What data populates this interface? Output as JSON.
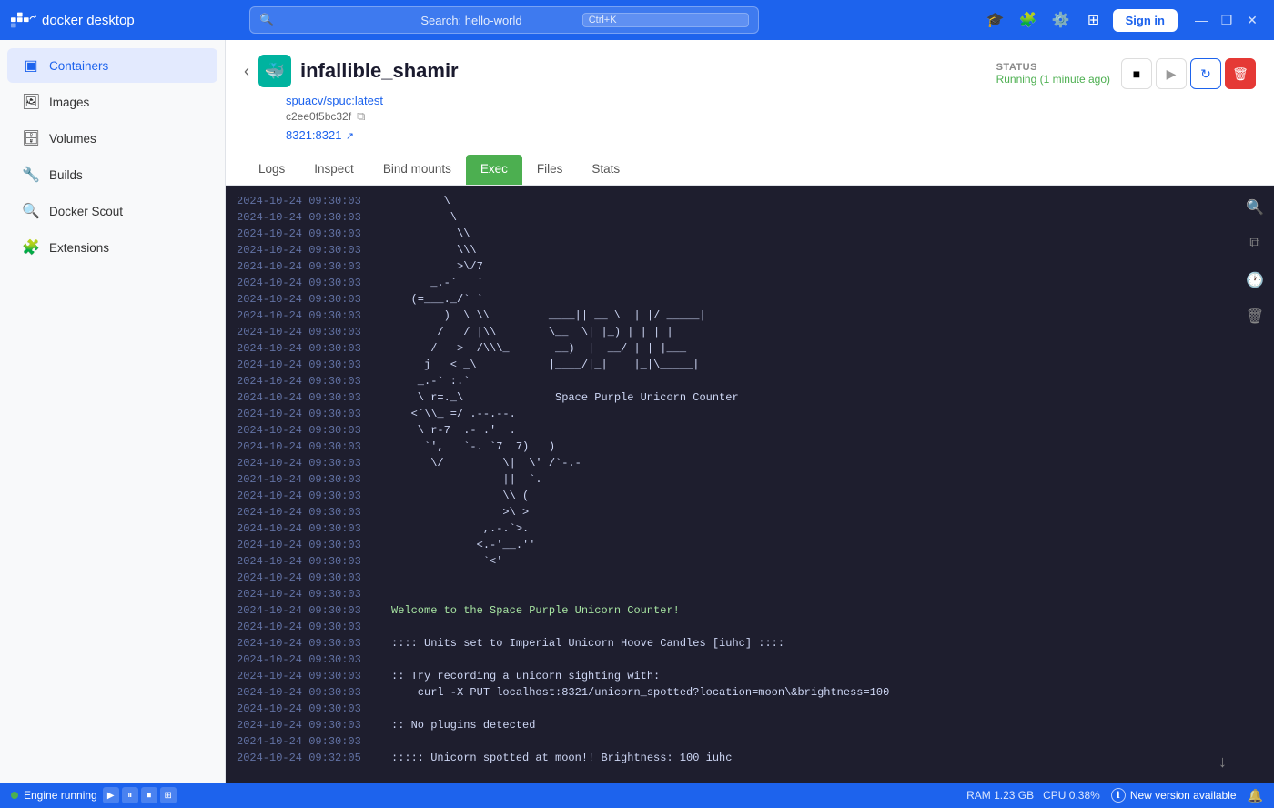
{
  "app": {
    "title": "Docker Desktop",
    "logo_text": "docker desktop"
  },
  "topbar": {
    "search_placeholder": "Search: hello-world",
    "shortcut": "Ctrl+K",
    "sign_in_label": "Sign in",
    "win_minimize": "—",
    "win_maximize": "❐",
    "win_close": "✕"
  },
  "sidebar": {
    "items": [
      {
        "id": "containers",
        "label": "Containers",
        "icon": "▣",
        "active": true
      },
      {
        "id": "images",
        "label": "Images",
        "icon": "🖼"
      },
      {
        "id": "volumes",
        "label": "Volumes",
        "icon": "🗄"
      },
      {
        "id": "builds",
        "label": "Builds",
        "icon": "🔧"
      },
      {
        "id": "docker-scout",
        "label": "Docker Scout",
        "icon": "🔍"
      },
      {
        "id": "extensions",
        "label": "Extensions",
        "icon": "🧩"
      }
    ]
  },
  "container": {
    "name": "infallible_shamir",
    "image_link": "spuacv/spuc:latest",
    "id": "c2ee0f5bc32f",
    "port": "8321:8321",
    "status_label": "STATUS",
    "status_text": "Running (1 minute ago)"
  },
  "tabs": [
    {
      "id": "logs",
      "label": "Logs",
      "active": false
    },
    {
      "id": "inspect",
      "label": "Inspect",
      "active": false
    },
    {
      "id": "bind-mounts",
      "label": "Bind mounts",
      "active": false
    },
    {
      "id": "exec",
      "label": "Exec",
      "active": true
    },
    {
      "id": "files",
      "label": "Files",
      "active": false
    },
    {
      "id": "stats",
      "label": "Stats",
      "active": false
    }
  ],
  "logs": [
    {
      "ts": "2024-10-24 09:30:03",
      "content": "        \\"
    },
    {
      "ts": "2024-10-24 09:30:03",
      "content": "         \\"
    },
    {
      "ts": "2024-10-24 09:30:03",
      "content": "          \\\\"
    },
    {
      "ts": "2024-10-24 09:30:03",
      "content": "          \\\\\\"
    },
    {
      "ts": "2024-10-24 09:30:03",
      "content": "          >\\/7"
    },
    {
      "ts": "2024-10-24 09:30:03",
      "content": "      _.-`   `"
    },
    {
      "ts": "2024-10-24 09:30:03",
      "content": "   (=___._/` `"
    },
    {
      "ts": "2024-10-24 09:30:03",
      "content": "        )  \\ \\\\         ____|| __ \\  | |/ _____|"
    },
    {
      "ts": "2024-10-24 09:30:03",
      "content": "       /   / |\\\\        \\__  \\| |_) | | | |"
    },
    {
      "ts": "2024-10-24 09:30:03",
      "content": "      /   >  /\\\\\\_       __)  |  __/ | | |___"
    },
    {
      "ts": "2024-10-24 09:30:03",
      "content": "     j   < _\\           |____/|_|    |_|\\_____|"
    },
    {
      "ts": "2024-10-24 09:30:03",
      "content": "    _.-` :.`"
    },
    {
      "ts": "2024-10-24 09:30:03",
      "content": "    \\ r=._\\              Space Purple Unicorn Counter"
    },
    {
      "ts": "2024-10-24 09:30:03",
      "content": "   <`\\\\_ =/ .--.--."
    },
    {
      "ts": "2024-10-24 09:30:03",
      "content": "    \\ r-7  .- .'  ."
    },
    {
      "ts": "2024-10-24 09:30:03",
      "content": "     `',   `-. `7  7)   )"
    },
    {
      "ts": "2024-10-24 09:30:03",
      "content": "      \\/         \\|  \\' /`-.-"
    },
    {
      "ts": "2024-10-24 09:30:03",
      "content": "                 ||  `."
    },
    {
      "ts": "2024-10-24 09:30:03",
      "content": "                 \\\\ ("
    },
    {
      "ts": "2024-10-24 09:30:03",
      "content": "                 >\\ >"
    },
    {
      "ts": "2024-10-24 09:30:03",
      "content": "              ,.-.`>."
    },
    {
      "ts": "2024-10-24 09:30:03",
      "content": "             <.-'__.''"
    },
    {
      "ts": "2024-10-24 09:30:03",
      "content": "              `<'"
    },
    {
      "ts": "2024-10-24 09:30:03",
      "content": ""
    },
    {
      "ts": "2024-10-24 09:30:03",
      "content": ""
    },
    {
      "ts": "2024-10-24 09:30:03",
      "content": "Welcome to the Space Purple Unicorn Counter!",
      "highlight": true
    },
    {
      "ts": "2024-10-24 09:30:03",
      "content": ""
    },
    {
      "ts": "2024-10-24 09:30:03",
      "content": ":::: Units set to Imperial Unicorn Hoove Candles [iuhc] ::::"
    },
    {
      "ts": "2024-10-24 09:30:03",
      "content": ""
    },
    {
      "ts": "2024-10-24 09:30:03",
      "content": ":: Try recording a unicorn sighting with:"
    },
    {
      "ts": "2024-10-24 09:30:03",
      "content": "    curl -X PUT localhost:8321/unicorn_spotted?location=moon\\&brightness=100"
    },
    {
      "ts": "2024-10-24 09:30:03",
      "content": ""
    },
    {
      "ts": "2024-10-24 09:30:03",
      "content": ":: No plugins detected"
    },
    {
      "ts": "2024-10-24 09:30:03",
      "content": ""
    },
    {
      "ts": "2024-10-24 09:32:05",
      "content": "::::: Unicorn spotted at moon!! Brightness: 100 iuhc"
    }
  ],
  "bottom_bar": {
    "engine_label": "Engine running",
    "ram_label": "RAM 1.23 GB",
    "cpu_label": "CPU 0.38%",
    "new_version_label": "New version available"
  }
}
